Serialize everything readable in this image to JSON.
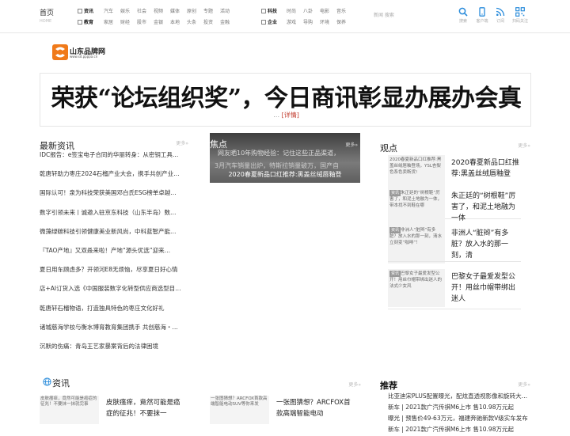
{
  "nav": {
    "home": "首页",
    "home_sub": "HOME",
    "group1": [
      "资讯",
      "教育"
    ],
    "group2": [
      "汽车",
      "家居",
      "娱乐",
      "财经",
      "社会",
      "股市",
      "视频",
      "金银",
      "媒体",
      "本地",
      "原创",
      "头条",
      "专题",
      "投资",
      "活动",
      "金融"
    ],
    "group3": [
      "科技",
      "企业"
    ],
    "group4": [
      "时尚",
      "游戏",
      "八卦",
      "导购",
      "电影",
      "环境",
      "音乐",
      "保养"
    ],
    "news_search": "新闻 搜索",
    "tools": [
      {
        "label": "搜索",
        "icon": "search-icon"
      },
      {
        "label": "客户端",
        "icon": "phone-icon"
      },
      {
        "label": "订阅",
        "icon": "rss-icon"
      },
      {
        "label": "扫码关注",
        "icon": "qrcode-icon"
      }
    ]
  },
  "logo": {
    "name": "山东品牌网",
    "url": "www.sd.ppppa.cn"
  },
  "banner": {
    "headline": "荣获“论坛组织奖”，今日商讯彰显办展办会真",
    "ellipsis": "…",
    "detail": "[详情]"
  },
  "latest": {
    "title": "最新资讯",
    "more": "更多»",
    "items": [
      "IDC报告：e签宝电子合同的华丽转身：从密钥工具…",
      "乾唐轩助力枣庄2024石榴产业大会，携手共创产业…",
      "国际认可！泉为科技荣获美国邓白氏ESG榜单卓越…",
      "数字引领未来丨诚邀入驻京东科技（山东半岛）数…",
      "微藻绿碳科技引领健康美业新风尚，中科蓝智产能…",
      "『TAO产地』又双叒来啦！产地“源头优选”迎来…",
      "夏日用车顾虑多？开领河E8无烦恼，尽享夏日好心情",
      "店+AI订货入选《中国服装数字化转型供应商选型目…",
      "乾唐轩石榴物语，打造独具特色的枣庄文化好礼",
      "诸城慈海学校与衡水博育教育集团携手 共创慈海・…",
      "沉默的伤痛：青岛王艺家暴案背后的法律困境"
    ]
  },
  "focus": {
    "title": "焦点",
    "more": "更多»",
    "line1": "网友晒10年购物经验：记住这些正品渠道，",
    "line2": "3月汽车销量出炉，特斯拉销量破万，国产自",
    "line3": "2020春夏新品口红推荐:黑盖丝绒唇釉登"
  },
  "views": {
    "title": "观点",
    "more": "更多»",
    "items": [
      {
        "thumb_tag": "",
        "thumb_text": "2020春夏新品口红推荐:黑盖丝绒唇釉登场，YSL杏梨色系色卖断货!",
        "text": "2020春夏新品口红推荐:黑盖丝绒唇釉登"
      },
      {
        "thumb_tag": "资讯",
        "thumb_text": "朱正廷的“树根鞋”厉害了，和泥土地融为一体，带本找不到鞋在哪",
        "text": "朱正廷的“树根鞋”厉害了，和泥土地融为一体"
      },
      {
        "thumb_tag": "资讯",
        "thumb_text": "非洲人“脏辫”有多脏？放入水的那一刻，清水立刻变“咖啡”！",
        "text": "非洲人“脏辫”有多脏？放入水的那一刻，清"
      },
      {
        "thumb_tag": "资讯",
        "thumb_text": "巴黎女子最爱发型公开！用丝巾帽带绑出迷人的法式少女风",
        "text": "巴黎女子最爱发型公开！用丝巾帽带绑出迷人"
      }
    ]
  },
  "zixun": {
    "title": "资讯",
    "more": "更多»",
    "cards": [
      {
        "thumb_text": "皮肤瘙痒，竟然可能是癌症的征兆！不要抹一抹就完事",
        "text": "皮肤瘙痒，竟然可能是癌症的征兆！不要抹一"
      },
      {
        "thumb_text": "一张图猜想？ARCFOX首款高端智能电动SUV等你来发",
        "text": "一张图猜想？ARCFOX首款高端智能电动"
      }
    ]
  },
  "recommend": {
    "title": "推荐",
    "more": "更多»",
    "items": [
      "比亚迪宋PLUS配置曝光，配炫直透视影像和旋转大…",
      "新车 | 2021款广汽传祺M6上市 售10.98万元起",
      "曝光 | 预售价49-63万元，福建奔驰新款V级实车发布",
      "新车 | 2021款广汽传祺M6上市 售10.98万元起"
    ]
  },
  "colors": {
    "accent": "#2a8cdb",
    "link_red": "#c0392b",
    "logo_orange": "#f07a1a"
  }
}
